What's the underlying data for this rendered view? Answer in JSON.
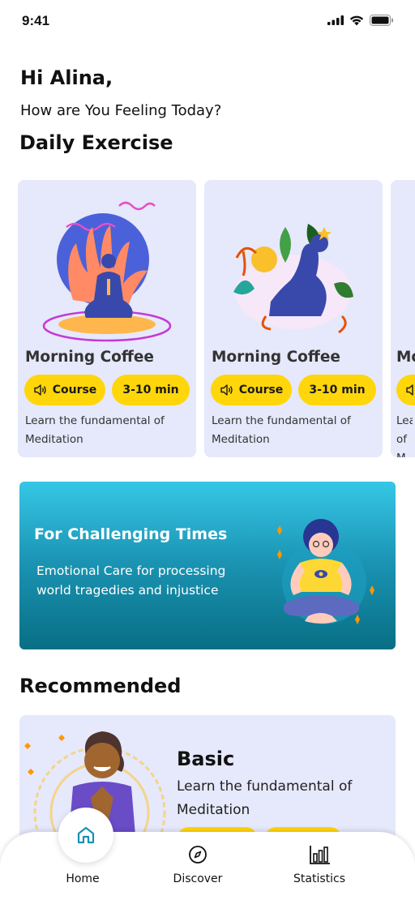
{
  "status_bar": {
    "time": "9:41"
  },
  "header": {
    "greeting": "Hi Alina,",
    "subtitle": "How are You Feeling Today?"
  },
  "daily_exercise": {
    "title": "Daily Exercise",
    "cards": [
      {
        "title": "Morning Coffee",
        "type_label": "Course",
        "duration": "3-10 min",
        "description": "Learn the fundamental of Meditation"
      },
      {
        "title": "Morning Coffee",
        "type_label": "Course",
        "duration": "3-10 min",
        "description": "Learn the fundamental of Meditation"
      },
      {
        "title": "Mo",
        "description": "Lea of M"
      }
    ]
  },
  "banner": {
    "title": "For Challenging Times",
    "description": "Emotional Care for processing world tragedies and injustice"
  },
  "recommended": {
    "title": "Recommended",
    "card": {
      "title": "Basic",
      "description": "Learn the fundamental of Meditation"
    }
  },
  "tab_bar": {
    "items": [
      {
        "label": "Home",
        "icon": "home-icon"
      },
      {
        "label": "Discover",
        "icon": "compass-icon"
      },
      {
        "label": "Statistics",
        "icon": "bar-chart-icon"
      }
    ]
  },
  "colors": {
    "card_background": "#e6e8fb",
    "pill": "#ffd60a",
    "banner_top": "#36c7e6",
    "banner_bottom": "#086f85",
    "home_icon": "#1a92b1"
  }
}
